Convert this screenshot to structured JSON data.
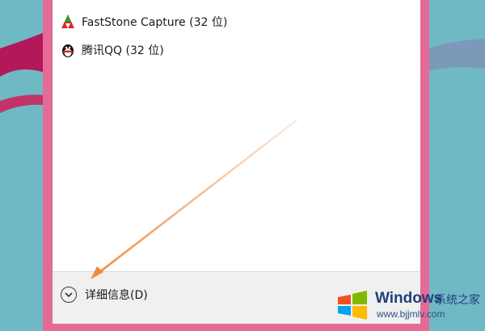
{
  "apps": [
    {
      "label": "FastStone Capture (32 位)",
      "icon": "faststone-capture-icon"
    },
    {
      "label": "腾讯QQ (32 位)",
      "icon": "qq-penguin-icon"
    }
  ],
  "bottom_bar": {
    "more_details_label": "详细信息(D)",
    "chevron_icon": "chevron-down-circle-icon"
  },
  "watermark": {
    "title": "Windows",
    "subtitle": "系统之家",
    "url": "www.bjjmlv.com"
  },
  "colors": {
    "desktop": "#6fb9c5",
    "frame": "#e46b97",
    "arrow": "#f08a3c"
  }
}
